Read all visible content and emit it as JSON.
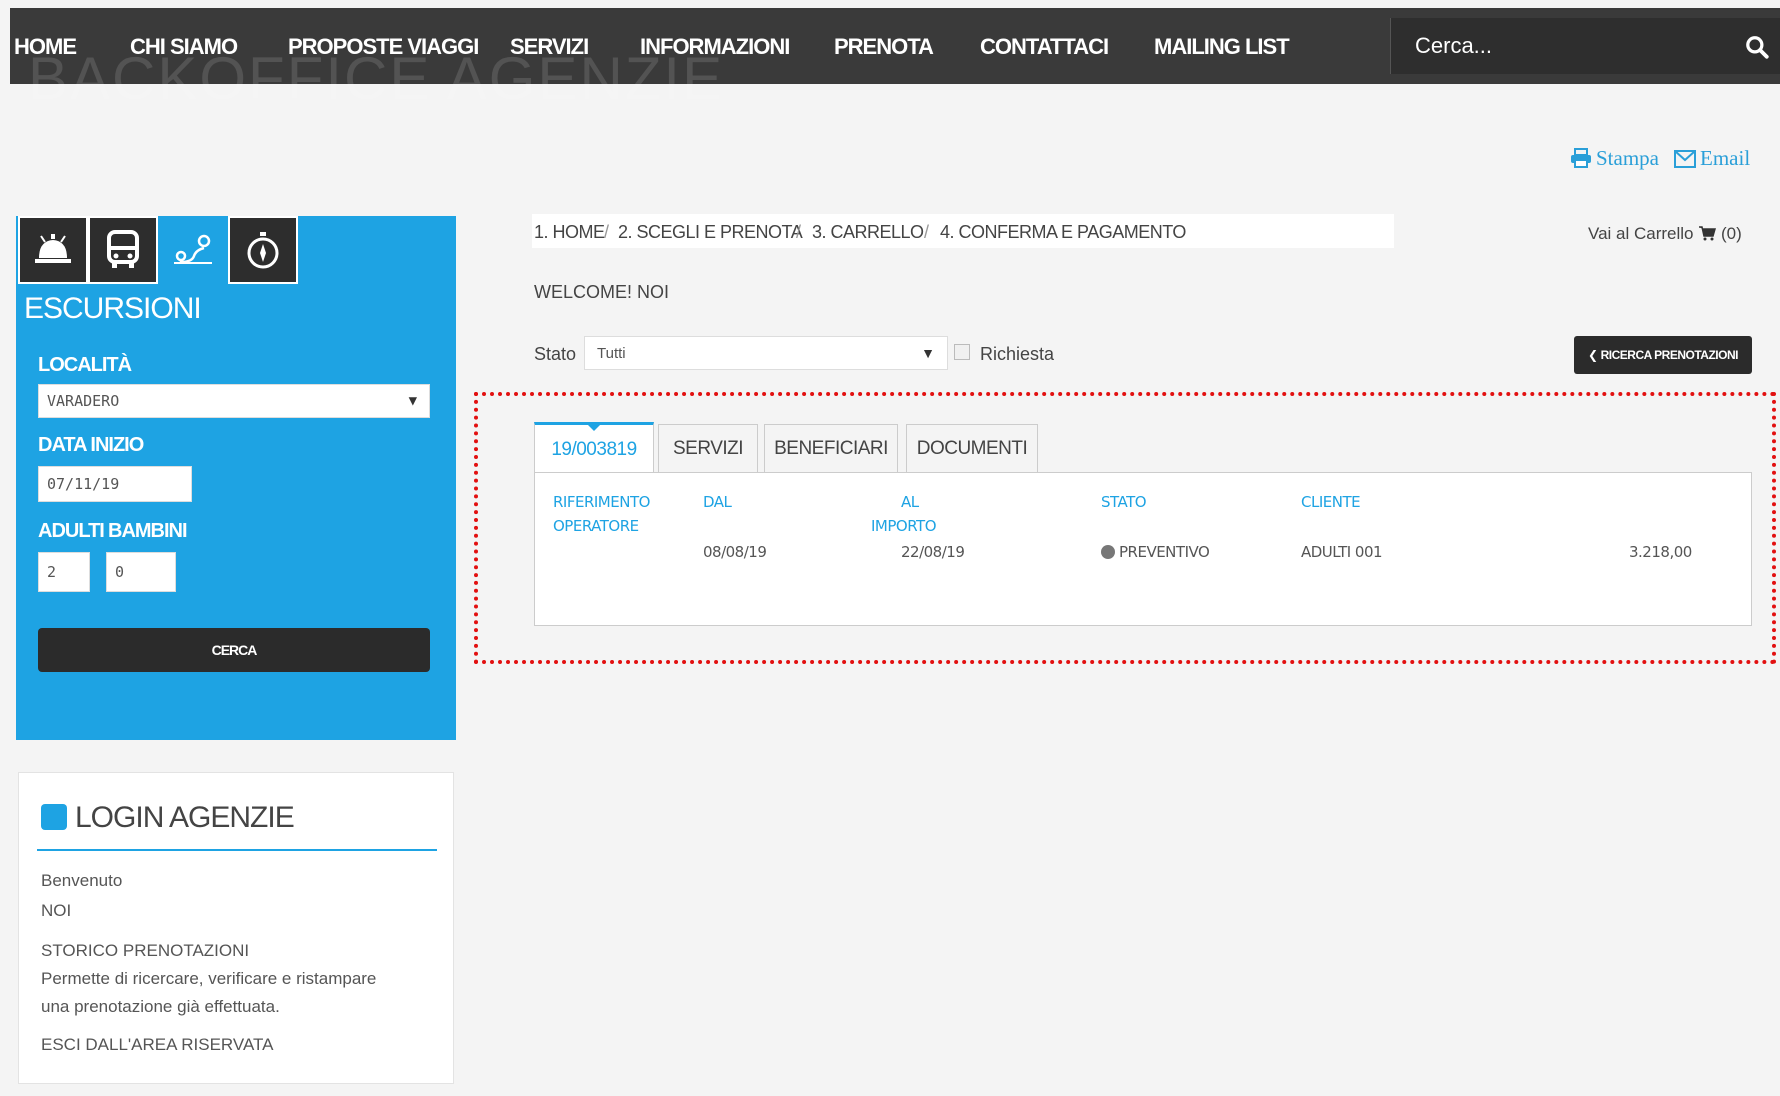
{
  "nav": {
    "items": [
      "HOME",
      "CHI SIAMO",
      "PROPOSTE VIAGGI",
      "SERVIZI",
      "INFORMAZIONI",
      "PRENOTA",
      "CONTATTACI",
      "MAILING LIST"
    ],
    "ghost_title": "BACKOFFICE AGENZIE",
    "search_placeholder": "Cerca..."
  },
  "toplinks": {
    "print": "Stampa",
    "email": "Email"
  },
  "sidebar": {
    "category_tabs": [
      "hotel-bell-icon",
      "bus-icon",
      "map-route-icon",
      "compass-icon"
    ],
    "title": "ESCURSIONI",
    "localita_label": "LOCALITÀ",
    "localita_value": "VARADERO",
    "data_inizio_label": "DATA INIZIO",
    "data_inizio_value": "07/11/19",
    "adulti_label": "ADULTI",
    "bambini_label": "BAMBINI",
    "adulti_value": "2",
    "bambini_value": "0",
    "search_button": "CERCA"
  },
  "login": {
    "title": "LOGIN AGENZIE",
    "benvenuto": "Benvenuto",
    "user": "NOI",
    "storico": "STORICO PRENOTAZIONI",
    "desc_line1": "Permette di ricercare, verificare e ristampare",
    "desc_line2": "una prenotazione già effettuata.",
    "logout": "ESCI DALL'AREA RISERVATA"
  },
  "breadcrumb": {
    "step1": "1. HOME",
    "step2": "2. SCEGLI E PRENOTA",
    "step3": "3. CARRELLO",
    "step4": "4. CONFERMA E PAGAMENTO",
    "separator": "/"
  },
  "cart": {
    "label": "Vai al Carrello",
    "count": "(0)"
  },
  "welcome": "WELCOME! NOI",
  "filter": {
    "stato_label": "Stato",
    "stato_value": "Tutti",
    "richiesta_label": "Richiesta",
    "ricerca_button": "RICERCA PRENOTAZIONI"
  },
  "booking": {
    "tabs": [
      "19/003819",
      "SERVIZI",
      "BENEFICIARI",
      "DOCUMENTI"
    ],
    "headers": {
      "riferimento": "RIFERIMENTO",
      "operatore": "OPERATORE",
      "dal": "DAL",
      "al": "AL",
      "importo": "IMPORTO",
      "stato": "STATO",
      "cliente": "CLIENTE"
    },
    "values": {
      "dal": "08/08/19",
      "al": "22/08/19",
      "stato": "PREVENTIVO",
      "cliente": "ADULTI 001",
      "importo": "3.218,00"
    }
  },
  "colors": {
    "accent": "#1ea3e3",
    "nav_bg": "#3a3a3a",
    "highlight": "#e21010"
  }
}
